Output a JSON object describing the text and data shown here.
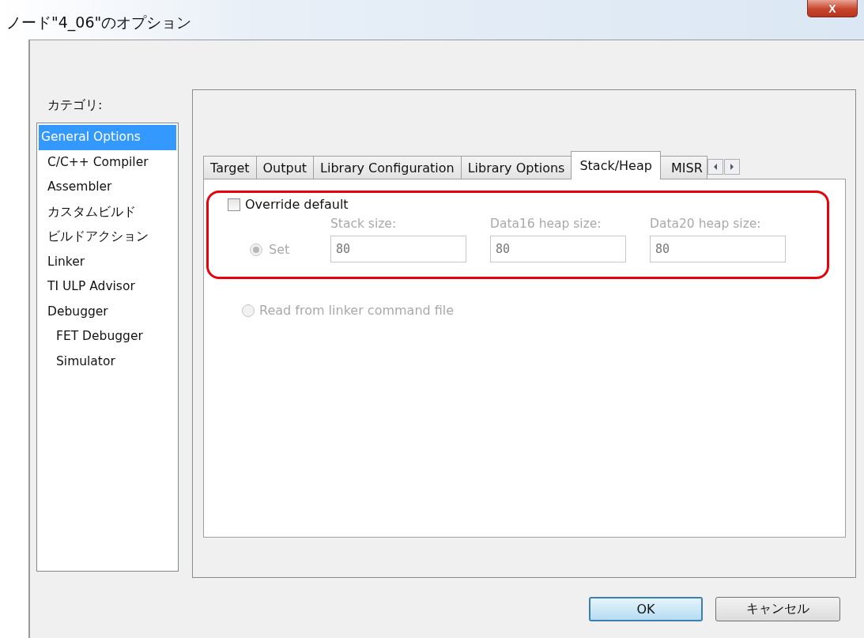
{
  "window": {
    "title": "ノード\"4_06\"のオプション",
    "close": "X"
  },
  "category": {
    "label": "カテゴリ:",
    "items": [
      {
        "label": "General Options",
        "selected": true
      },
      {
        "label": "C/C++ Compiler",
        "selected": false
      },
      {
        "label": "Assembler",
        "selected": false
      },
      {
        "label": "カスタムビルド",
        "selected": false
      },
      {
        "label": "ビルドアクション",
        "selected": false
      },
      {
        "label": "Linker",
        "selected": false
      },
      {
        "label": "TI ULP Advisor",
        "selected": false
      },
      {
        "label": "Debugger",
        "selected": false,
        "children": [
          {
            "label": "FET Debugger",
            "selected": false
          },
          {
            "label": "Simulator",
            "selected": false
          }
        ]
      }
    ]
  },
  "tabs": [
    {
      "label": "Target",
      "selected": false
    },
    {
      "label": "Output",
      "selected": false
    },
    {
      "label": "Library Configuration",
      "selected": false
    },
    {
      "label": "Library Options",
      "selected": false
    },
    {
      "label": "Stack/Heap",
      "selected": true
    },
    {
      "label": "MISR",
      "selected": false
    }
  ],
  "options": {
    "override": {
      "label": "Override default",
      "checked": false
    },
    "set": {
      "label": "Set",
      "selected": true,
      "disabled": true
    },
    "fields": [
      {
        "label": "Stack size:",
        "value": "80",
        "disabled": true
      },
      {
        "label": "Data16 heap size:",
        "value": "80",
        "disabled": true
      },
      {
        "label": "Data20 heap size:",
        "value": "80",
        "disabled": true
      }
    ],
    "read": {
      "label": "Read from linker command file",
      "selected": false,
      "disabled": true
    }
  },
  "buttons": [
    {
      "label": "OK",
      "kind": "default"
    },
    {
      "label": "キャンセル",
      "kind": "normal"
    }
  ]
}
